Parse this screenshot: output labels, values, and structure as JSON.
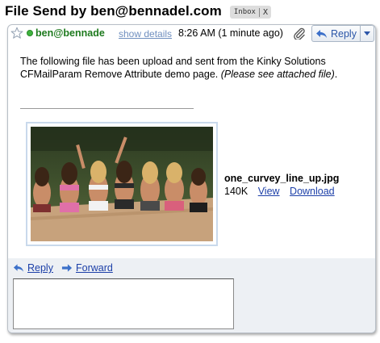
{
  "subject": "File Send by ben@bennadel.com",
  "label": {
    "name": "Inbox",
    "close": "X"
  },
  "message": {
    "sender": "ben@bennade",
    "show_details": "show details",
    "time": "8:26 AM (1 minute ago)",
    "reply_label": "Reply",
    "body": "The following file has been upload and sent from the Kinky Solutions CFMailParam Remove Attribute demo page.",
    "body_note": "(Please see attached file)",
    "body_end": "."
  },
  "attachment": {
    "filename": "one_curvey_line_up.jpg",
    "size": "140K",
    "view_label": "View",
    "download_label": "Download"
  },
  "footer": {
    "reply_label": "Reply",
    "forward_label": "Forward",
    "reply_value": ""
  },
  "colors": {
    "sender_green": "#1e7a1e",
    "online_green": "#3fb33f",
    "link_blue": "#1c3fa8",
    "button_text_blue": "#2b56a8",
    "footer_bg": "#edf0f4",
    "attachment_border": "#c9d9ec"
  },
  "icons": {
    "star": "star-outline-icon",
    "presence": "online-status-dot-icon",
    "attachment": "paperclip-icon",
    "reply": "reply-arrow-icon",
    "more": "dropdown-triangle-icon",
    "forward": "forward-arrow-icon"
  }
}
